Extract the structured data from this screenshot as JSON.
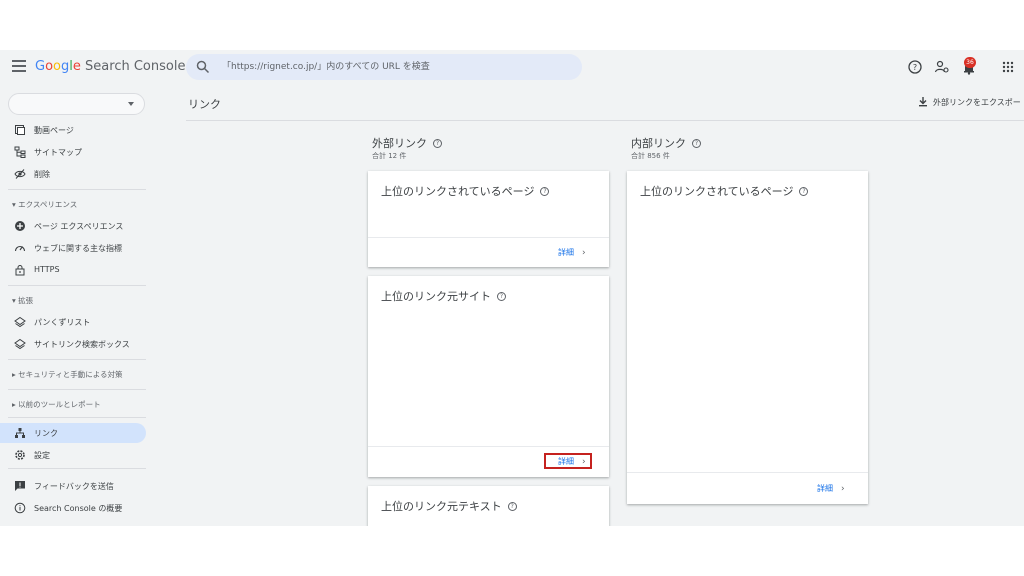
{
  "header": {
    "app_title": {
      "google": "Google",
      "product": "Search Console"
    },
    "search_placeholder": "「https://rignet.co.jp/」内のすべての URL を検査",
    "notification_count": "36"
  },
  "sidebar": {
    "property_value": "",
    "top_items": [
      {
        "label": "動画ページ",
        "icon": "video-page-icon"
      },
      {
        "label": "サイトマップ",
        "icon": "sitemap-icon"
      },
      {
        "label": "削除",
        "icon": "removal-icon"
      }
    ],
    "sections": {
      "experience": "エクスペリエンス",
      "enhancements": "拡張",
      "security": "セキュリティと手動による対策",
      "legacy": "以前のツールとレポート"
    },
    "experience_items": [
      {
        "label": "ページ エクスペリエンス",
        "icon": "page-experience-icon"
      },
      {
        "label": "ウェブに関する主な指標",
        "icon": "web-vitals-icon"
      },
      {
        "label": "HTTPS",
        "icon": "lock-icon"
      }
    ],
    "enhancement_items": [
      {
        "label": "パンくずリスト",
        "icon": "layers-icon"
      },
      {
        "label": "サイトリンク検索ボックス",
        "icon": "layers-icon"
      }
    ],
    "bottom_items": [
      {
        "label": "リンク",
        "icon": "links-icon",
        "active": true
      },
      {
        "label": "設定",
        "icon": "settings-icon"
      },
      {
        "label": "フィードバックを送信",
        "icon": "feedback-icon"
      },
      {
        "label": "Search Console の概要",
        "icon": "info-icon"
      }
    ]
  },
  "main": {
    "page_title": "リンク",
    "export_label": "外部リンクをエクスポー",
    "external": {
      "heading": "外部リンク",
      "total": "合計 12 件",
      "cards": [
        {
          "title": "上位のリンクされているページ",
          "detail": "詳細"
        },
        {
          "title": "上位のリンク元サイト",
          "detail": "詳細"
        },
        {
          "title": "上位のリンク元テキスト"
        }
      ]
    },
    "internal": {
      "heading": "内部リンク",
      "total": "合計 856 件",
      "cards": [
        {
          "title": "上位のリンクされているページ",
          "detail": "詳細"
        }
      ]
    }
  },
  "colors": {
    "accent": "#1a73e8",
    "active_nav": "#d2e3fc",
    "highlight_box": "#c5221f",
    "badge": "#d93025"
  }
}
